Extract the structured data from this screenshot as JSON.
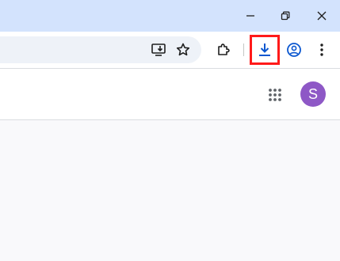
{
  "window": {
    "controls": [
      "minimize-icon",
      "restore-icon",
      "close-icon"
    ]
  },
  "toolbar": {
    "icons": [
      "install-app-icon",
      "bookmark-star-icon",
      "extensions-icon",
      "download-icon",
      "profile-icon",
      "more-menu-icon"
    ],
    "download_highlight_color": "#ff1a1a",
    "accent_color": "#0b57d0"
  },
  "page": {
    "apps_icon": "apps-grid-icon",
    "avatar": {
      "letter": "S",
      "color": "#8e58c6"
    }
  },
  "colors": {
    "titlebar": "#d3e3fd",
    "omnibox": "#eef2f8",
    "content_bg": "#f9f9fb"
  }
}
